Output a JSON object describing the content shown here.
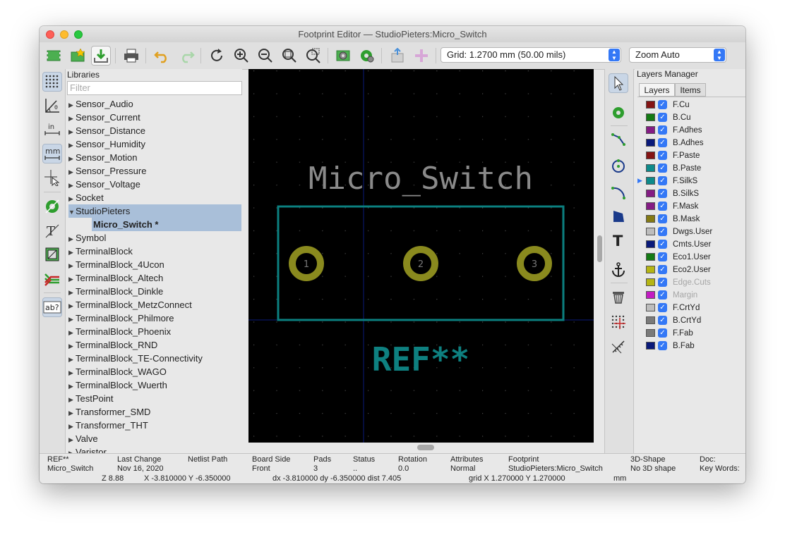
{
  "window": {
    "title": "Footprint Editor — StudioPieters:Micro_Switch"
  },
  "toolbar": {
    "grid_label": "Grid: 1.2700 mm (50.00 mils)",
    "zoom_label": "Zoom Auto",
    "icons": [
      "new-footprint",
      "create-footprint-wizard",
      "save",
      "print",
      "undo",
      "redo",
      "redraw",
      "zoom-in",
      "zoom-out",
      "zoom-fit",
      "zoom-area",
      "footprint-properties",
      "pad-settings",
      "insert-footprint",
      "load-footprint-from-board"
    ]
  },
  "left_toolbar": {
    "icons": [
      "grid-dots",
      "polar-coords",
      "inch-units",
      "mm-units",
      "cursor-shape",
      "show-pads",
      "show-text",
      "show-edges",
      "high-contrast",
      "ab-text"
    ]
  },
  "libraries": {
    "header": "Libraries",
    "filter_placeholder": "Filter",
    "items": [
      {
        "label": "Sensor_Audio"
      },
      {
        "label": "Sensor_Current"
      },
      {
        "label": "Sensor_Distance"
      },
      {
        "label": "Sensor_Humidity"
      },
      {
        "label": "Sensor_Motion"
      },
      {
        "label": "Sensor_Pressure"
      },
      {
        "label": "Sensor_Voltage"
      },
      {
        "label": "Socket"
      },
      {
        "label": "StudioPieters",
        "expanded": true,
        "selected": true
      },
      {
        "label": "Micro_Switch *",
        "child": true
      },
      {
        "label": "Symbol"
      },
      {
        "label": "TerminalBlock"
      },
      {
        "label": "TerminalBlock_4Ucon"
      },
      {
        "label": "TerminalBlock_Altech"
      },
      {
        "label": "TerminalBlock_Dinkle"
      },
      {
        "label": "TerminalBlock_MetzConnect"
      },
      {
        "label": "TerminalBlock_Philmore"
      },
      {
        "label": "TerminalBlock_Phoenix"
      },
      {
        "label": "TerminalBlock_RND"
      },
      {
        "label": "TerminalBlock_TE-Connectivity"
      },
      {
        "label": "TerminalBlock_WAGO"
      },
      {
        "label": "TerminalBlock_Wuerth"
      },
      {
        "label": "TestPoint"
      },
      {
        "label": "Transformer_SMD"
      },
      {
        "label": "Transformer_THT"
      },
      {
        "label": "Valve"
      },
      {
        "label": "Varistor"
      }
    ]
  },
  "canvas": {
    "value_text": "Micro_Switch",
    "ref_text": "REF**",
    "pads": [
      "1",
      "2",
      "3"
    ],
    "colors": {
      "background": "#000000",
      "silk": "#007f7f",
      "value": "#8a8a8a",
      "pad": "#8a8a1e",
      "ref": "#0e8080"
    }
  },
  "right_toolbar": {
    "icons": [
      "select-arrow",
      "add-pad",
      "add-line",
      "add-circle",
      "add-arc",
      "add-polygon",
      "add-text",
      "set-anchor",
      "delete",
      "grid-origin",
      "measure"
    ]
  },
  "layers": {
    "header": "Layers Manager",
    "tabs": [
      {
        "label": "Layers",
        "active": true
      },
      {
        "label": "Items"
      }
    ],
    "items": [
      {
        "name": "F.Cu",
        "color": "#841414"
      },
      {
        "name": "B.Cu",
        "color": "#147a14"
      },
      {
        "name": "F.Adhes",
        "color": "#841c84"
      },
      {
        "name": "B.Adhes",
        "color": "#0a1a7a"
      },
      {
        "name": "F.Paste",
        "color": "#841414"
      },
      {
        "name": "B.Paste",
        "color": "#0d8a8a"
      },
      {
        "name": "F.SilkS",
        "color": "#0d8a8a",
        "current": true
      },
      {
        "name": "B.SilkS",
        "color": "#841c84"
      },
      {
        "name": "F.Mask",
        "color": "#841c84"
      },
      {
        "name": "B.Mask",
        "color": "#847a14"
      },
      {
        "name": "Dwgs.User",
        "color": "#bdbdbd"
      },
      {
        "name": "Cmts.User",
        "color": "#0a1a7a"
      },
      {
        "name": "Eco1.User",
        "color": "#147a14"
      },
      {
        "name": "Eco2.User",
        "color": "#b5b514"
      },
      {
        "name": "Edge.Cuts",
        "color": "#b5b514",
        "dim": true
      },
      {
        "name": "Margin",
        "color": "#c21cc2",
        "dim": true
      },
      {
        "name": "F.CrtYd",
        "color": "#bdbdbd"
      },
      {
        "name": "B.CrtYd",
        "color": "#7a7a7a"
      },
      {
        "name": "F.Fab",
        "color": "#7a7a7a"
      },
      {
        "name": "B.Fab",
        "color": "#0a1a7a"
      }
    ]
  },
  "status": {
    "ref_label": "REF**",
    "ref_value": "Micro_Switch",
    "last_change_label": "Last Change",
    "last_change_value": "Nov 16, 2020",
    "netlist_label": "Netlist Path",
    "netlist_value": "",
    "board_side_label": "Board Side",
    "board_side_value": "Front",
    "pads_label": "Pads",
    "pads_value": "3",
    "status_label": "Status",
    "status_value": "..",
    "rotation_label": "Rotation",
    "rotation_value": "0.0",
    "attributes_label": "Attributes",
    "attributes_value": "Normal",
    "footprint_label": "Footprint",
    "footprint_value": "StudioPieters:Micro_Switch",
    "shape3d_label": "3D-Shape",
    "shape3d_value": "No 3D shape",
    "doc_label": "Doc:",
    "keywords_label": "Key Words:",
    "zoom": "Z 8.88",
    "coords": "X -3.810000  Y -6.350000",
    "delta": "dx -3.810000  dy -6.350000  dist 7.405",
    "grid": "grid X 1.270000  Y 1.270000",
    "units": "mm"
  }
}
